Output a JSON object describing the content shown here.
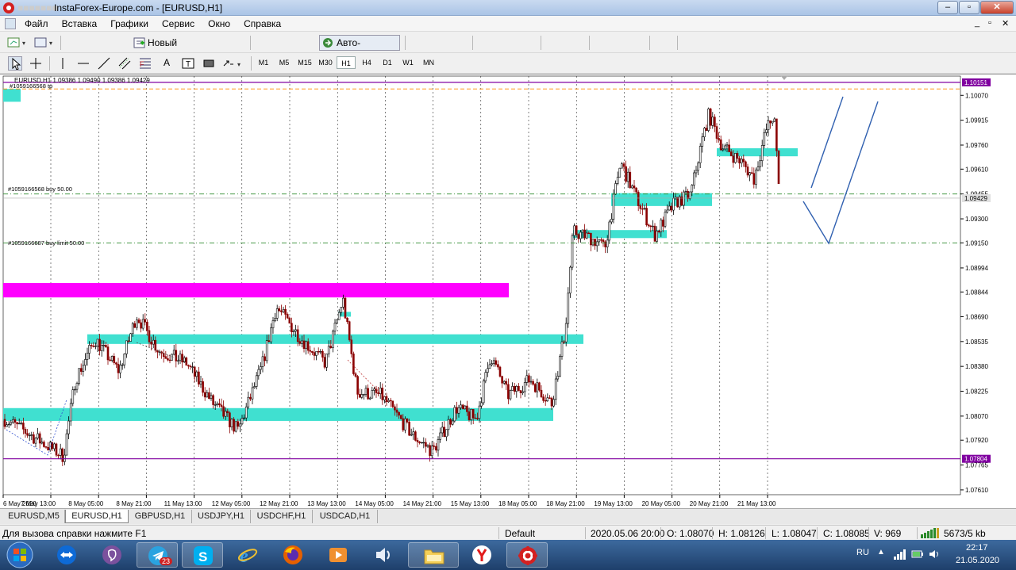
{
  "window": {
    "title": "InstaForex-Europe.com - [EURUSD,H1]",
    "account_masked": "■■■■■■■"
  },
  "menu": [
    "Файл",
    "Вставка",
    "Графики",
    "Сервис",
    "Окно",
    "Справка"
  ],
  "toolbar1": {
    "new_order": "Новый ордер",
    "auto_trading": "Авто-торговля"
  },
  "timeframes": [
    "M1",
    "M5",
    "M15",
    "M30",
    "H1",
    "H4",
    "D1",
    "W1",
    "MN"
  ],
  "active_timeframe": "H1",
  "chart": {
    "header": "EURUSD,H1  1.09386 1.09490 1.09386 1.09429",
    "order_top_label": "#1059166568 tp",
    "order_buy_label": "#1059166568 buy 50.00",
    "order_limit_label": "#1059166687 buy limit 50.00",
    "price_labels": [
      "1.10070",
      "1.09915",
      "1.09760",
      "1.09610",
      "1.09455",
      "1.09300",
      "1.09150",
      "1.08994",
      "1.08844",
      "1.08690",
      "1.08535",
      "1.08380",
      "1.08225",
      "1.08070",
      "1.07920",
      "1.07765",
      "1.07610"
    ],
    "price_highlights": {
      "top": "1.10151",
      "current": "1.09429",
      "bottom": "1.07804"
    },
    "time_labels": [
      "6 May 2020",
      "7 May 13:00",
      "8 May 05:00",
      "8 May 21:00",
      "11 May 13:00",
      "12 May 05:00",
      "12 May 21:00",
      "13 May 13:00",
      "14 May 05:00",
      "14 May 21:00",
      "15 May 13:00",
      "18 May 05:00",
      "18 May 21:00",
      "19 May 13:00",
      "20 May 05:00",
      "20 May 21:00",
      "21 May 13:00"
    ],
    "price_min": 1.0758,
    "price_max": 1.1019,
    "colors": {
      "up": "#000000",
      "down": "#8b0000",
      "zone": "#40e0d0",
      "magenta": "#ff00ff",
      "purple": "#8000a0",
      "order": "#2e8b2e",
      "tp": "#ff8c00",
      "pen": "#3060b0"
    }
  },
  "chart_tabs": [
    "EURUSD,M5",
    "EURUSD,H1",
    "GBPUSD,H1",
    "USDJPY,H1",
    "USDCHF,H1",
    "USDCAD,H1"
  ],
  "active_tab": "EURUSD,H1",
  "status": {
    "help": "Для вызова справки нажмите F1",
    "profile": "Default",
    "datetime": "2020.05.06 20:00",
    "open": "O: 1.08070",
    "high": "H: 1.08126",
    "low": "L: 1.08047",
    "close": "C: 1.08085",
    "volume": "V: 969",
    "traffic": "5673/5 kb"
  },
  "taskbar": {
    "lang": "RU",
    "time": "22:17",
    "date": "21.05.2020",
    "telegram_badge": "23",
    "apps": [
      "start",
      "teamviewer",
      "viber",
      "telegram",
      "skype",
      "internet-explorer",
      "firefox",
      "video-player",
      "audio",
      "file-explorer",
      "yandex-browser",
      "instaforex-terminal"
    ]
  }
}
